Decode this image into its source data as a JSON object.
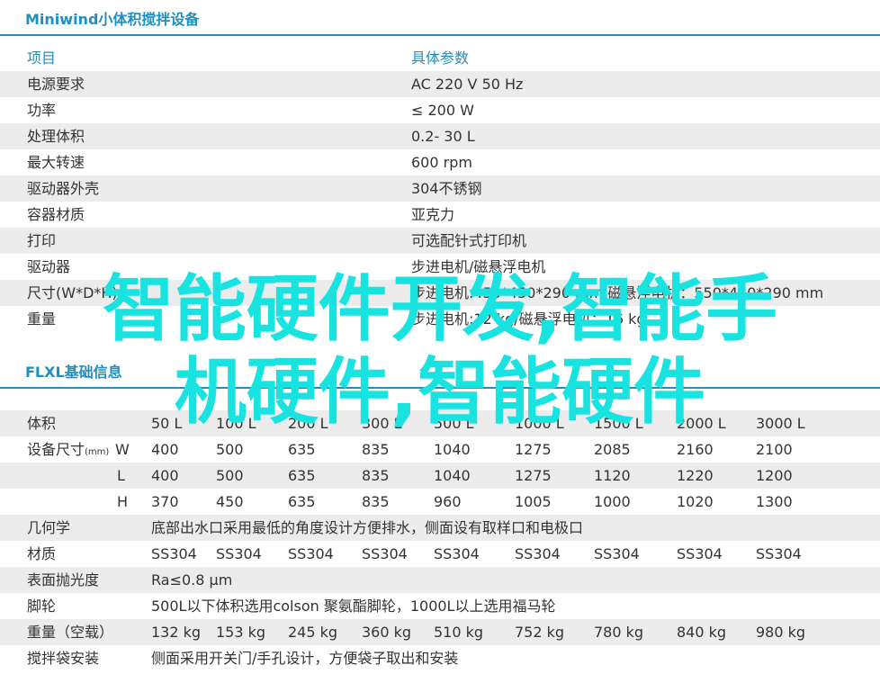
{
  "section1": {
    "title": "Miniwind小体积搅拌设备",
    "header": {
      "item": "项目",
      "spec": "具体参数"
    },
    "rows": [
      {
        "item": "电源要求",
        "spec": "AC 220  V 50 Hz"
      },
      {
        "item": "功率",
        "spec": "≤ 200 W"
      },
      {
        "item": "处理体积",
        "spec": "0.2- 30 L"
      },
      {
        "item": "最大转速",
        "spec": "600  rpm"
      },
      {
        "item": "驱动器外壳",
        "spec": "304不锈钢"
      },
      {
        "item": "容器材质",
        "spec": "亚克力"
      },
      {
        "item": "打印",
        "spec": "可选配针式打印机"
      },
      {
        "item": "驱动器",
        "spec": "步进电机/磁悬浮电机"
      },
      {
        "item": "尺寸(W*D*H)",
        "spec": "步进电机:450*450*290 mm   磁悬浮电机：550*450*290 mm"
      },
      {
        "item": "重量",
        "spec": "步进电机:12 kg/磁悬浮电机：16 kg"
      }
    ]
  },
  "section2": {
    "title": "FLXL基础信息",
    "volume_label": "体积",
    "volumes": [
      "50 L",
      "100 L",
      "200 L",
      "300 L",
      "500 L",
      "1000 L",
      "1500 L",
      "2000 L",
      "3000 L"
    ],
    "size_label": "设备尺寸",
    "size_unit": "(mm)",
    "dim_W": "W",
    "dim_L": "L",
    "dim_H": "H",
    "W": [
      "400",
      "500",
      "635",
      "835",
      "1040",
      "1275",
      "2085",
      "2160",
      "2100"
    ],
    "L": [
      "400",
      "500",
      "635",
      "835",
      "1040",
      "1275",
      "1120",
      "1220",
      "1200"
    ],
    "H": [
      "370",
      "450",
      "635",
      "835",
      "960",
      "1005",
      "1000",
      "1020",
      "1300"
    ],
    "geometry_label": "几何学",
    "geometry": "底部出水口采用最低的角度设计方便排水，侧面设有取样口和电极口",
    "material_label": "材质",
    "material": [
      "SS304",
      "SS304",
      "SS304",
      "SS304",
      "SS304",
      "SS304",
      "SS304",
      "SS304",
      "SS304"
    ],
    "polish_label": "表面抛光度",
    "polish": "Ra≤0.8 μm",
    "caster_label": "脚轮",
    "caster": "500L以下体积选用colson 聚氨酯脚轮，1000L以上选用福马轮",
    "weight_label": "重量（空载）",
    "weight": [
      "132 kg",
      "153 kg",
      "245 kg",
      "360 kg",
      "510 kg",
      "752 kg",
      "780 kg",
      "840 kg",
      "980 kg"
    ],
    "bag_label": "搅拌袋安装",
    "bag": "侧面采用开关门/手孔设计，方便袋子取出和安装"
  },
  "overlay": {
    "line1": "智能硬件开发,智能手",
    "line2": "机硬件,智能硬件"
  },
  "colors": {
    "accent": "#1f8fbf",
    "shade": "#ececec",
    "overlay": "#19e3e0"
  }
}
